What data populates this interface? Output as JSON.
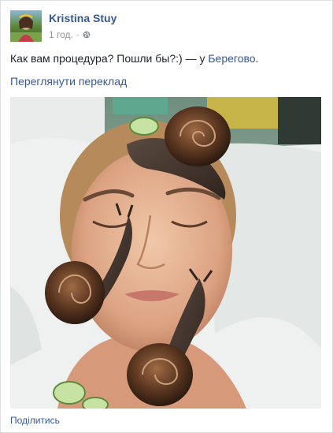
{
  "post": {
    "author": "Kristina Stuy",
    "time": "1 год.",
    "separator": "·",
    "text_main": "Как вам процедура? Пошли бы?:) — у ",
    "location": "Берегово",
    "text_end": ".",
    "translate_link": "Переглянути переклад",
    "share_link": "Поділитись"
  },
  "icons": {
    "audience": "globe-icon"
  }
}
